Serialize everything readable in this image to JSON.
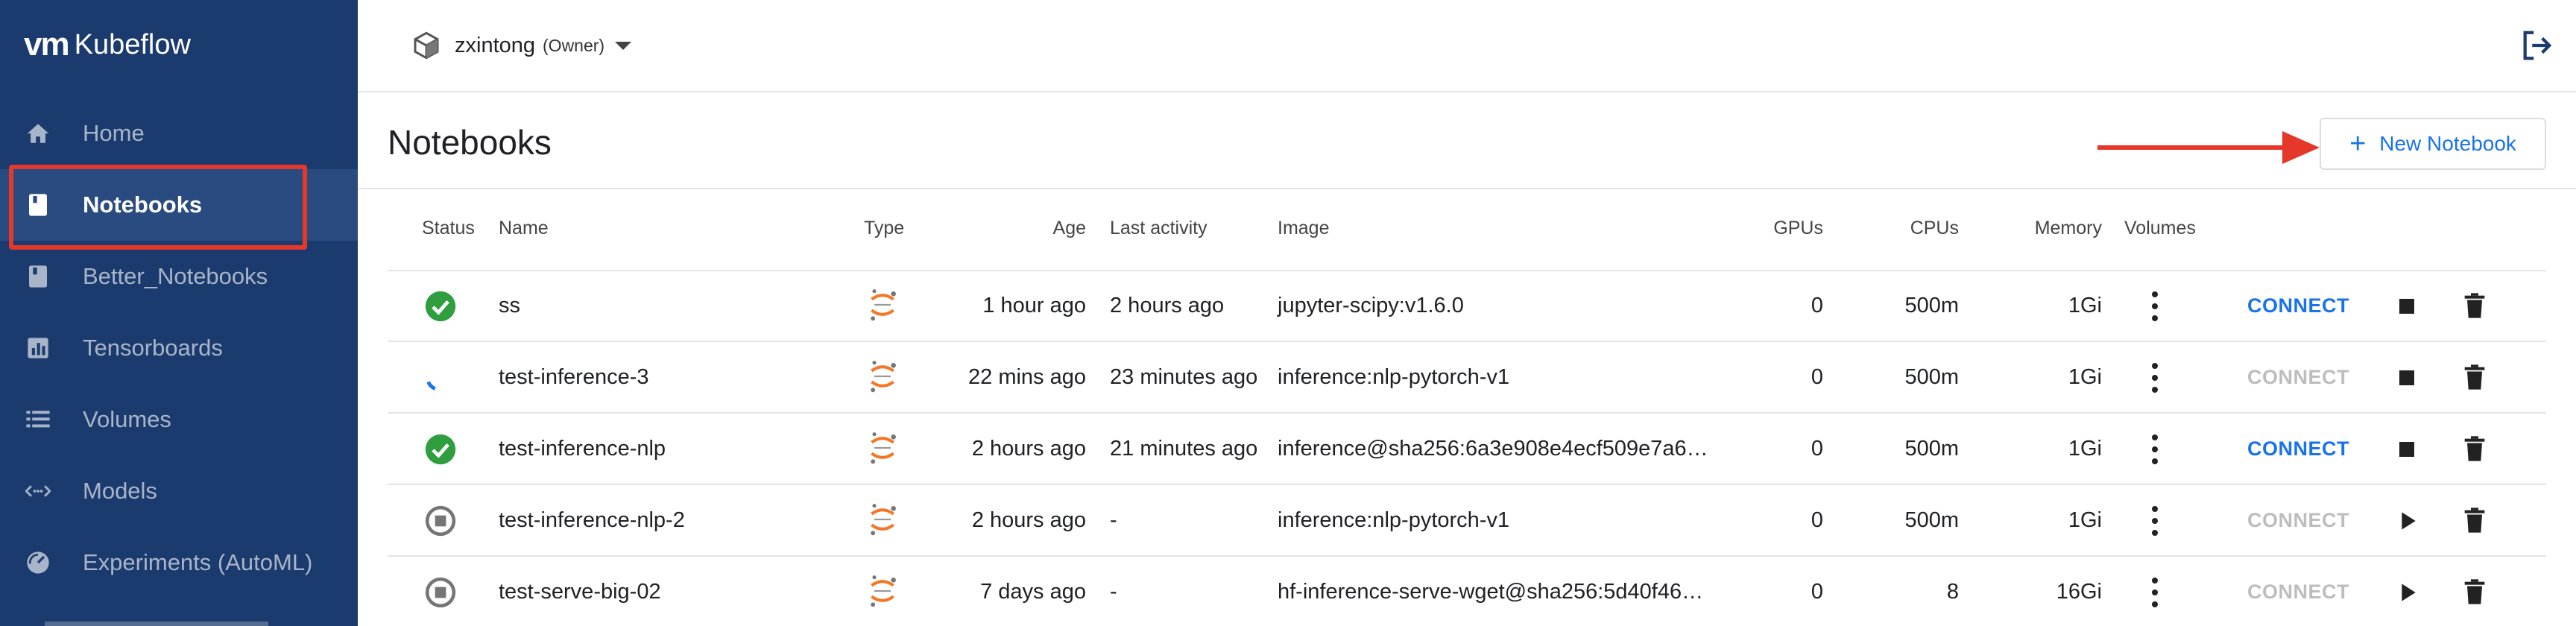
{
  "app": {
    "logo_mark": "vm",
    "logo_name": "Kubeflow"
  },
  "sidebar": {
    "items": [
      {
        "label": "Home",
        "icon": "home-icon",
        "active": false
      },
      {
        "label": "Notebooks",
        "icon": "notebook-icon",
        "active": true
      },
      {
        "label": "Better_Notebooks",
        "icon": "notebook-icon",
        "active": false
      },
      {
        "label": "Tensorboards",
        "icon": "chart-icon",
        "active": false
      },
      {
        "label": "Volumes",
        "icon": "list-icon",
        "active": false
      },
      {
        "label": "Models",
        "icon": "code-arrows-icon",
        "active": false
      },
      {
        "label": "Experiments (AutoML)",
        "icon": "speedometer-icon",
        "active": false
      }
    ]
  },
  "namespace": {
    "name": "zxintong",
    "role": "(Owner)"
  },
  "page": {
    "title": "Notebooks",
    "new_button_label": "New Notebook"
  },
  "table": {
    "headers": {
      "status": "Status",
      "name": "Name",
      "type": "Type",
      "age": "Age",
      "last_activity": "Last activity",
      "image": "Image",
      "gpus": "GPUs",
      "cpus": "CPUs",
      "memory": "Memory",
      "volumes": "Volumes"
    },
    "rows": [
      {
        "status": "running",
        "name": "ss",
        "type": "jupyter",
        "age": "1 hour ago",
        "last_activity": "2 hours ago",
        "image": "jupyter-scipy:v1.6.0",
        "gpus": "0",
        "cpus": "500m",
        "memory": "1Gi",
        "connect": "CONNECT",
        "connect_enabled": true,
        "action": "stop"
      },
      {
        "status": "loading",
        "name": "test-inference-3",
        "type": "jupyter",
        "age": "22 mins ago",
        "last_activity": "23 minutes ago",
        "image": "inference:nlp-pytorch-v1",
        "gpus": "0",
        "cpus": "500m",
        "memory": "1Gi",
        "connect": "CONNECT",
        "connect_enabled": false,
        "action": "stop"
      },
      {
        "status": "running",
        "name": "test-inference-nlp",
        "type": "jupyter",
        "age": "2 hours ago",
        "last_activity": "21 minutes ago",
        "image": "inference@sha256:6a3e908e4ecf509e7a6…",
        "gpus": "0",
        "cpus": "500m",
        "memory": "1Gi",
        "connect": "CONNECT",
        "connect_enabled": true,
        "action": "stop"
      },
      {
        "status": "stopped",
        "name": "test-inference-nlp-2",
        "type": "jupyter",
        "age": "2 hours ago",
        "last_activity": "-",
        "image": "inference:nlp-pytorch-v1",
        "gpus": "0",
        "cpus": "500m",
        "memory": "1Gi",
        "connect": "CONNECT",
        "connect_enabled": false,
        "action": "start"
      },
      {
        "status": "stopped",
        "name": "test-serve-big-02",
        "type": "jupyter",
        "age": "7 days ago",
        "last_activity": "-",
        "image": "hf-inference-serve-wget@sha256:5d40f46…",
        "gpus": "0",
        "cpus": "8",
        "memory": "16Gi",
        "connect": "CONNECT",
        "connect_enabled": false,
        "action": "start"
      }
    ]
  },
  "colors": {
    "sidebar_bg": "#1b3b6e",
    "accent": "#1a73e8",
    "connect_disabled": "#bdbdbd",
    "status_ok": "#2e9e3e",
    "status_stopped": "#757575",
    "annotation": "#e5372a",
    "jupyter_orange": "#f37726"
  }
}
